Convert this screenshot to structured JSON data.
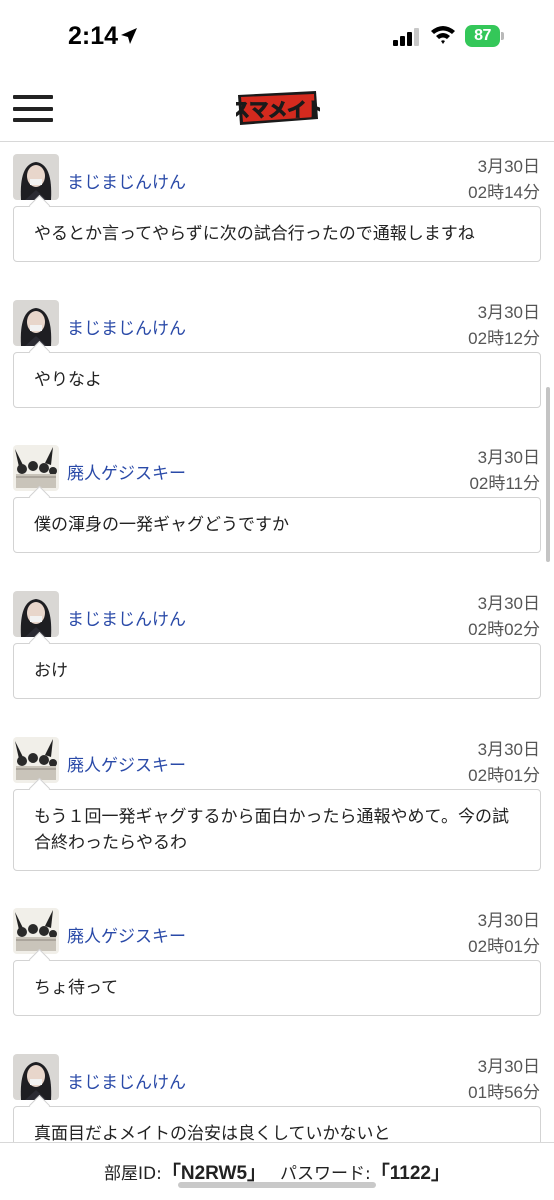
{
  "status_bar": {
    "time": "2:14",
    "battery": "87"
  },
  "header": {
    "logo_text": "スマメイト",
    "menu_icon": "hamburger-menu-icon"
  },
  "messages": [
    {
      "user": "まじまじんけん",
      "avatar": "avatar-girl",
      "date": "3月30日",
      "time": "02時14分",
      "text": "やるとか言ってやらずに次の試合行ったので通報しますね"
    },
    {
      "user": "まじまじんけん",
      "avatar": "avatar-girl",
      "date": "3月30日",
      "time": "02時12分",
      "text": "やりなよ"
    },
    {
      "user": "廃人ゲジスキー",
      "avatar": "avatar-group",
      "date": "3月30日",
      "time": "02時11分",
      "text": "僕の渾身の一発ギャグどうですか"
    },
    {
      "user": "まじまじんけん",
      "avatar": "avatar-girl",
      "date": "3月30日",
      "time": "02時02分",
      "text": "おけ"
    },
    {
      "user": "廃人ゲジスキー",
      "avatar": "avatar-group",
      "date": "3月30日",
      "time": "02時01分",
      "text": "もう１回一発ギャグするから面白かったら通報やめて。今の試合終わったらやるわ"
    },
    {
      "user": "廃人ゲジスキー",
      "avatar": "avatar-group",
      "date": "3月30日",
      "time": "02時01分",
      "text": "ちょ待って"
    },
    {
      "user": "まじまじんけん",
      "avatar": "avatar-girl",
      "date": "3月30日",
      "time": "01時56分",
      "text": "真面目だよメイトの治安は良くしていかないと"
    }
  ],
  "room_bar": {
    "room_label": "部屋ID:",
    "room_id": "「N2RW5」",
    "password_label": "パスワード:",
    "password": "「1122」"
  },
  "colors": {
    "username": "#2a4aa8",
    "battery": "#34c759",
    "logo_red": "#d42a1e"
  }
}
